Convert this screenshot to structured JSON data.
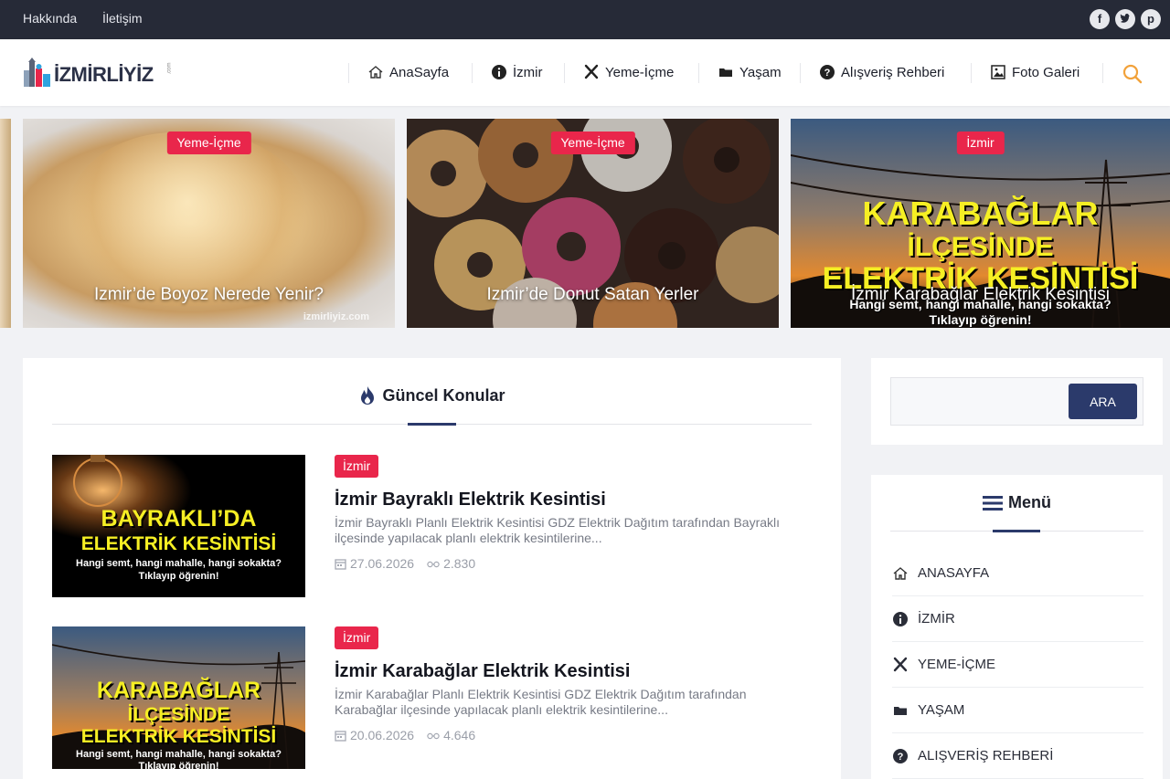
{
  "topbar": {
    "links": [
      "Hakkında",
      "İletişim"
    ],
    "social": [
      "facebook-icon",
      "twitter-icon",
      "pinterest-icon"
    ]
  },
  "header": {
    "logo_text": "İZMİRLİYİZ",
    "logo_small": ".com",
    "nav": [
      {
        "label": "AnaSayfa",
        "icon": "home-icon"
      },
      {
        "label": "İzmir",
        "icon": "info-icon"
      },
      {
        "label": "Yeme-İçme",
        "icon": "utensils-icon"
      },
      {
        "label": "Yaşam",
        "icon": "folder-icon"
      },
      {
        "label": "Alışveriş Rehberi",
        "icon": "question-icon"
      },
      {
        "label": "Foto Galeri",
        "icon": "image-icon"
      }
    ]
  },
  "slider": [
    {
      "category": "Yeme-İçme",
      "title": "Izmir’de Boyoz Nerede Yenir?",
      "watermark": "izmirliyiz.com"
    },
    {
      "category": "Yeme-İçme",
      "title": "Izmir’de Donut Satan Yerler"
    },
    {
      "category": "İzmir",
      "title": "İzmir Karabağlar Elektrik Kesintisi",
      "image_lines": [
        "KARABAĞLAR",
        "İLÇESİNDE",
        "ELEKTRİK KESİNTİSİ",
        "Hangi semt, hangi mahalle, hangi sokakta?",
        "Tıklayıp öğrenin!"
      ]
    }
  ],
  "section": {
    "title": "Güncel Konular"
  },
  "posts": [
    {
      "category": "İzmir",
      "title": "İzmir Bayraklı Elektrik Kesintisi",
      "excerpt": "İzmir Bayraklı Planlı Elektrik Kesintisi GDZ Elektrik Dağıtım tarafından Bayraklı ilçesinde yapılacak planlı elektrik kesintilerine...",
      "date": "27.06.2026",
      "views": "2.830",
      "image_lines": [
        "BAYRAKLI’DA",
        "ELEKTRİK KESİNTİSİ",
        "Hangi semt, hangi mahalle, hangi sokakta?",
        "Tıklayıp öğrenin!"
      ]
    },
    {
      "category": "İzmir",
      "title": "İzmir Karabağlar Elektrik Kesintisi",
      "excerpt": "İzmir Karabağlar Planlı Elektrik Kesintisi GDZ Elektrik Dağıtım tarafından Karabağlar ilçesinde yapılacak planlı elektrik kesintilerine...",
      "date": "20.06.2026",
      "views": "4.646",
      "image_lines": [
        "KARABAĞLAR",
        "İLÇESİNDE",
        "ELEKTRİK KESİNTİSİ",
        "Hangi semt, hangi mahalle, hangi sokakta?",
        "Tıklayıp öğrenin!"
      ]
    }
  ],
  "sidebar": {
    "search": {
      "button_label": "ARA",
      "placeholder": ""
    },
    "menu_title": "Menü",
    "menu": [
      {
        "label": "ANASAYFA",
        "icon": "home-icon"
      },
      {
        "label": "İZMİR",
        "icon": "info-icon"
      },
      {
        "label": "YEME-İÇME",
        "icon": "utensils-icon"
      },
      {
        "label": "YAŞAM",
        "icon": "folder-icon"
      },
      {
        "label": "ALIŞVERİŞ REHBERİ",
        "icon": "question-icon"
      }
    ]
  },
  "colors": {
    "topbar": "#262a37",
    "badge": "#e9264b",
    "accent": "#2b3a6b",
    "search_icon": "#f2a23a"
  }
}
